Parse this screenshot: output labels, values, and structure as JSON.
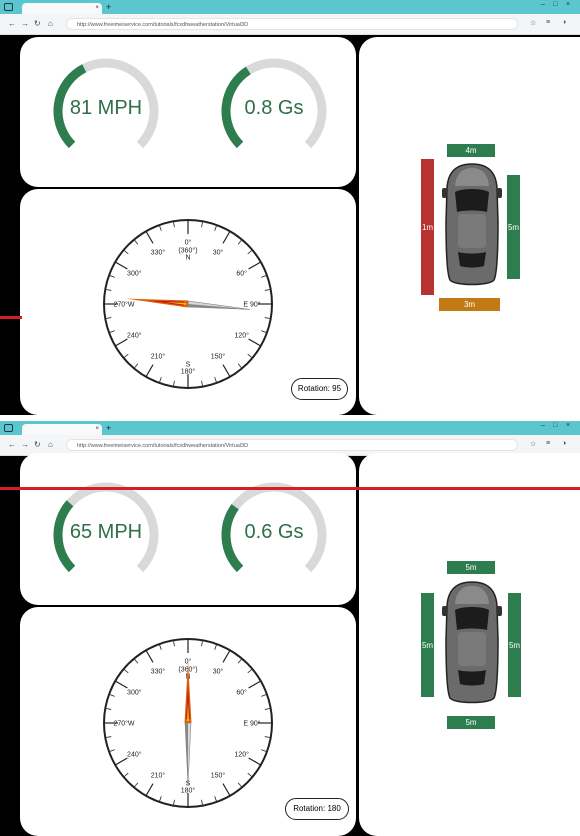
{
  "browser": {
    "url": "http://www.freeimeiservice.com/tutorials/fcxdhweatherstation/Virtual3D",
    "close_glyph": "×",
    "new_tab_glyph": "+",
    "window": {
      "min": "–",
      "max": "□",
      "close": "×"
    },
    "nav": {
      "back": "←",
      "forward": "→",
      "refresh": "↻",
      "home": "⌂"
    },
    "toolbar": {
      "star": "☆",
      "extensions": "≡",
      "profile": "◑"
    }
  },
  "colors": {
    "gauge_fill": "#2e7d4f",
    "gauge_track": "#d9d9d9",
    "sensor_ok": "#2e7d4f",
    "sensor_warn": "#c47a14",
    "sensor_danger": "#b83232"
  },
  "screens": [
    {
      "speed": {
        "label": "81 MPH",
        "fraction": 0.4
      },
      "gforce": {
        "label": "0.8 Gs",
        "fraction": 0.38
      },
      "compass": {
        "north_line1": "0°",
        "north_line2": "(360°)",
        "n": "N",
        "deg30": "30°",
        "deg60": "60°",
        "deg90": "E 90°",
        "deg120": "120°",
        "deg150": "150°",
        "s": "S",
        "deg180": "180°",
        "deg210": "210°",
        "deg240": "240°",
        "deg270": "270°W",
        "deg300": "300°",
        "deg330": "330°",
        "needle_rotation": 95
      },
      "rotation_label": "Rotation: 95",
      "sensors": {
        "front": {
          "label": "4m",
          "status": "ok"
        },
        "rear": {
          "label": "3m",
          "status": "warn"
        },
        "left": {
          "label": "1m",
          "status": "danger"
        },
        "right": {
          "label": "5m",
          "status": "ok"
        }
      }
    },
    {
      "speed": {
        "label": "65 MPH",
        "fraction": 0.32
      },
      "gforce": {
        "label": "0.6 Gs",
        "fraction": 0.3
      },
      "compass": {
        "north_line1": "0°",
        "north_line2": "(360°)",
        "n": "N",
        "deg30": "30°",
        "deg60": "60°",
        "deg90": "E 90°",
        "deg120": "120°",
        "deg150": "150°",
        "s": "S",
        "deg180": "180°",
        "deg210": "210°",
        "deg240": "240°",
        "deg270": "270°W",
        "deg300": "300°",
        "deg330": "330°",
        "needle_rotation": 180
      },
      "rotation_label": "Rotation: 180",
      "sensors": {
        "front": {
          "label": "5m",
          "status": "ok"
        },
        "rear": {
          "label": "5m",
          "status": "ok"
        },
        "left": {
          "label": "5m",
          "status": "ok"
        },
        "right": {
          "label": "5m",
          "status": "ok"
        }
      }
    }
  ]
}
